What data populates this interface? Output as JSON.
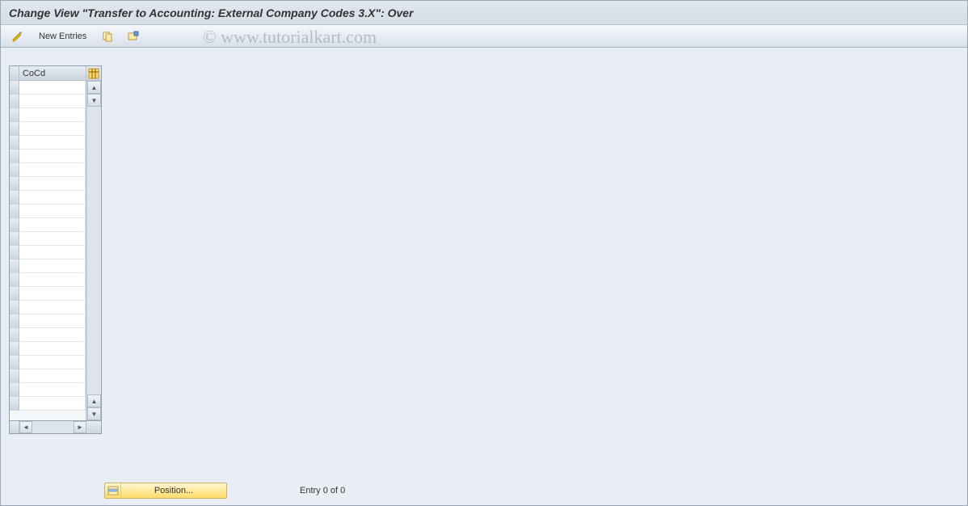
{
  "title": "Change View \"Transfer to Accounting: External Company Codes 3.X\": Over",
  "toolbar": {
    "other_view_icon": "pencil-glasses-icon",
    "new_entries_label": "New Entries",
    "copy_icon": "copy-icon",
    "delimit_icon": "delimit-icon"
  },
  "table": {
    "column_header": "CoCd",
    "config_icon": "table-settings-icon",
    "row_count": 24,
    "rows": [
      "",
      "",
      "",
      "",
      "",
      "",
      "",
      "",
      "",
      "",
      "",
      "",
      "",
      "",
      "",
      "",
      "",
      "",
      "",
      "",
      "",
      "",
      "",
      ""
    ]
  },
  "footer": {
    "position_label": "Position...",
    "entry_status": "Entry 0 of 0"
  },
  "watermark": "© www.tutorialkart.com"
}
